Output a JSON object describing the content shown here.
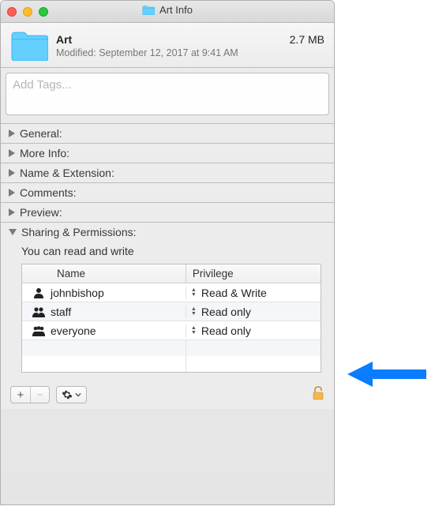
{
  "window": {
    "title": "Art Info"
  },
  "header": {
    "name": "Art",
    "size": "2.7 MB",
    "modified": "Modified: September 12, 2017 at 9:41 AM"
  },
  "tags": {
    "placeholder": "Add Tags..."
  },
  "sections": {
    "general": "General:",
    "moreinfo": "More Info:",
    "nameext": "Name & Extension:",
    "comments": "Comments:",
    "preview": "Preview:",
    "sharing": "Sharing & Permissions:"
  },
  "sharing": {
    "message": "You can read and write",
    "columns": {
      "name": "Name",
      "privilege": "Privilege"
    },
    "rows": [
      {
        "user": "johnbishop",
        "privilege": "Read & Write",
        "icon": "single"
      },
      {
        "user": "staff",
        "privilege": "Read only",
        "icon": "pair"
      },
      {
        "user": "everyone",
        "privilege": "Read only",
        "icon": "group"
      }
    ]
  },
  "toolbar": {
    "add": "+",
    "remove": "−"
  }
}
